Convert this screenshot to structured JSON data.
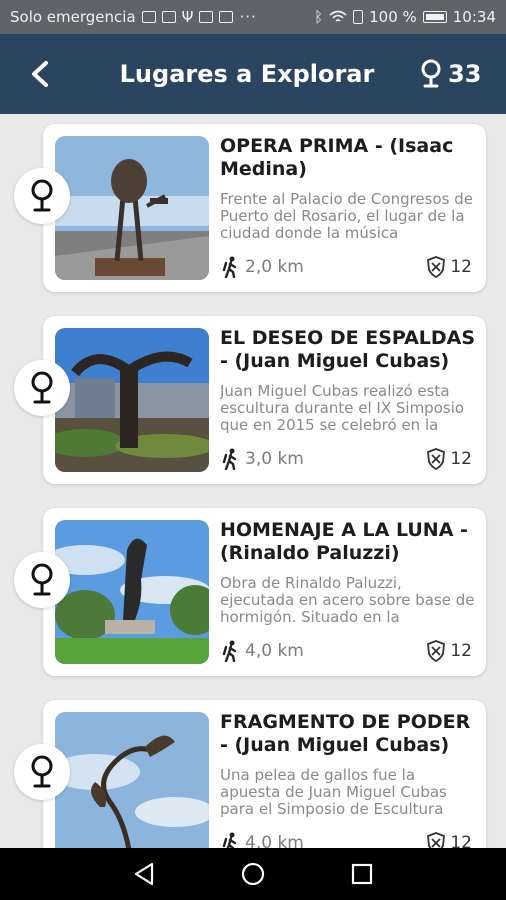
{
  "status_bar": {
    "carrier": "Solo emergencia",
    "dots": "···",
    "battery": "100 %",
    "time": "10:34"
  },
  "app_bar": {
    "title": "Lugares a Explorar",
    "count": "33"
  },
  "places": [
    {
      "title": "OPERA PRIMA - (Isaac Medina)",
      "description": "Frente al Palacio de Congresos de Puerto del Rosario, el lugar de la ciudad donde la música",
      "distance": "2,0 km",
      "points": "12"
    },
    {
      "title": "EL DESEO DE ESPALDAS - (Juan Miguel Cubas)",
      "description": "Juan Miguel Cubas realizó esta escultura durante el IX Simposio que en 2015 se celebró en la",
      "distance": "3,0 km",
      "points": "12"
    },
    {
      "title": "HOMENAJE A LA LUNA - (Rinaldo Paluzzi)",
      "description": "Obra de Rinaldo Paluzzi, ejecutada en acero sobre base de hormigón. Situado en la",
      "distance": "4,0 km",
      "points": "12"
    },
    {
      "title": "FRAGMENTO DE PODER - (Juan Miguel Cubas)",
      "description": "Una pelea de gallos fue la apuesta de Juan Miguel Cubas para el Simposio de Escultura",
      "distance": "4,0 km",
      "points": "12"
    }
  ],
  "colors": {
    "app_bar": "#2b4460",
    "status_bar": "#5f6468",
    "background": "#e9e9e9"
  },
  "icons": {
    "back": "arrow-left-icon",
    "marker": "map-pin-icon",
    "walk": "hiker-icon",
    "points": "shield-badge-icon"
  }
}
